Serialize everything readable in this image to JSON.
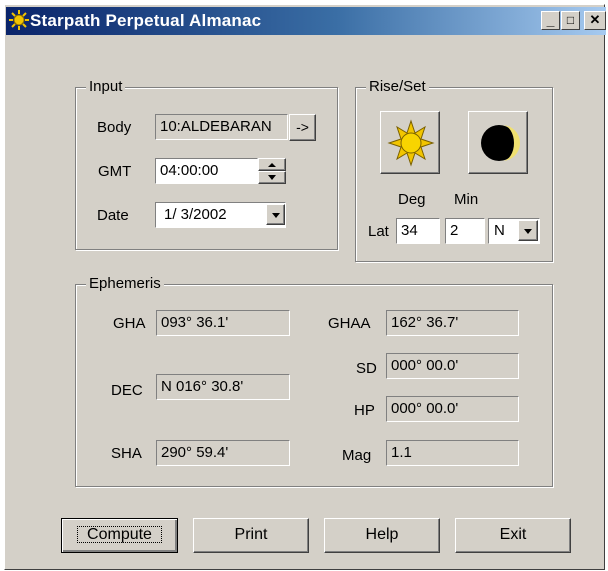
{
  "window": {
    "title": "Starpath Perpetual Almanac",
    "min_glyph": "_",
    "max_glyph": "□",
    "close_glyph": "✕"
  },
  "input": {
    "legend": "Input",
    "body_label": "Body",
    "body_value": "10:ALDEBARAN",
    "body_go": "->",
    "gmt_label": "GMT",
    "gmt_value": "04:00:00",
    "date_label": "Date",
    "date_value": "1/ 3/2002"
  },
  "riseset": {
    "legend": "Rise/Set",
    "deg_label": "Deg",
    "min_label": "Min",
    "lat_label": "Lat",
    "lat_deg": "34",
    "lat_min": "2",
    "lat_hemi": "N"
  },
  "ephemeris": {
    "legend": "Ephemeris",
    "gha_label": "GHA",
    "gha_value": "093° 36.1'",
    "dec_label": "DEC",
    "dec_value": "N 016° 30.8'",
    "sha_label": "SHA",
    "sha_value": "290° 59.4'",
    "ghaa_label": "GHAA",
    "ghaa_value": "162° 36.7'",
    "sd_label": "SD",
    "sd_value": "000° 00.0'",
    "hp_label": "HP",
    "hp_value": "000° 00.0'",
    "mag_label": "Mag",
    "mag_value": "1.1"
  },
  "buttons": {
    "compute": "Compute",
    "print": "Print",
    "help": "Help",
    "exit": "Exit"
  },
  "colors": {
    "face": "#d4d0c8",
    "title_start": "#0a246a",
    "title_end": "#a6caf0",
    "sun": "#f2c500",
    "moon_dark": "#000000",
    "moon_light": "#f0e070"
  }
}
